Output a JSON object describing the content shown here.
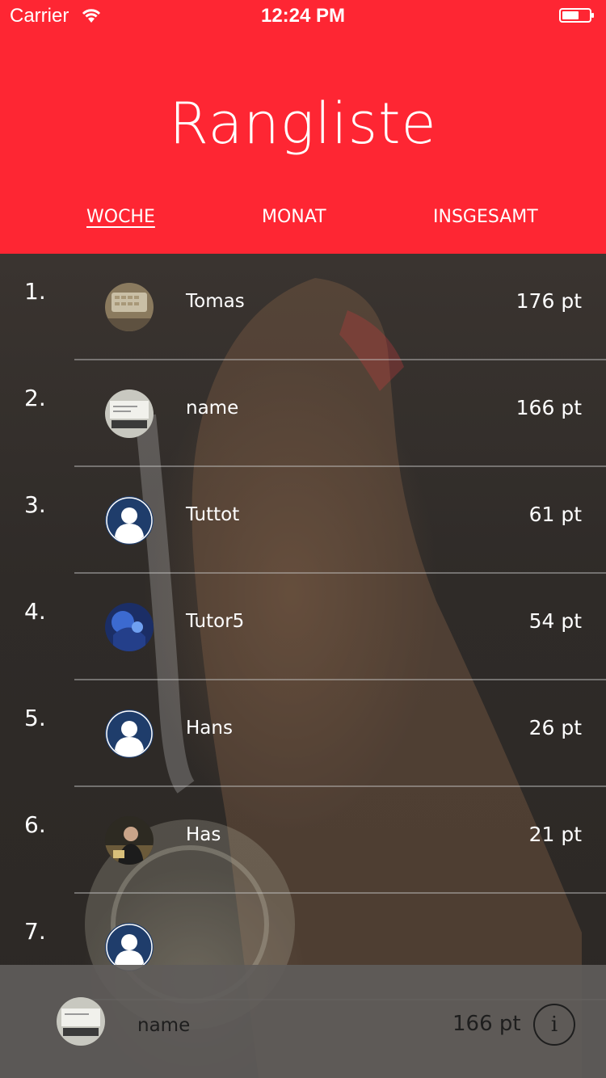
{
  "status_bar": {
    "carrier": "Carrier",
    "time": "12:24 PM"
  },
  "header": {
    "title": "Rangliste"
  },
  "tabs": [
    {
      "label": "WOCHE",
      "selected": true
    },
    {
      "label": "MONAT",
      "selected": false
    },
    {
      "label": "INSGESAMT",
      "selected": false
    }
  ],
  "leaderboard": [
    {
      "rank": "1.",
      "name": "Tomas",
      "points": "176 pt",
      "avatar": "photo-keyboard"
    },
    {
      "rank": "2.",
      "name": "name",
      "points": "166 pt",
      "avatar": "photo-screen"
    },
    {
      "rank": "3.",
      "name": "Tuttot",
      "points": "61 pt",
      "avatar": "default-user-icon"
    },
    {
      "rank": "4.",
      "name": "Tutor5",
      "points": "54 pt",
      "avatar": "photo-blue"
    },
    {
      "rank": "5.",
      "name": "Hans",
      "points": "26 pt",
      "avatar": "default-user-icon"
    },
    {
      "rank": "6.",
      "name": "Has",
      "points": "21 pt",
      "avatar": "photo-person"
    },
    {
      "rank": "7.",
      "name": "",
      "points": "",
      "avatar": "default-user-icon"
    }
  ],
  "current_user": {
    "name": "name",
    "points": "166 pt",
    "avatar": "photo-screen"
  },
  "info_button": {
    "label": "i"
  },
  "colors": {
    "accent": "#fe2633",
    "avatar_blue": "#1f3d6b"
  }
}
